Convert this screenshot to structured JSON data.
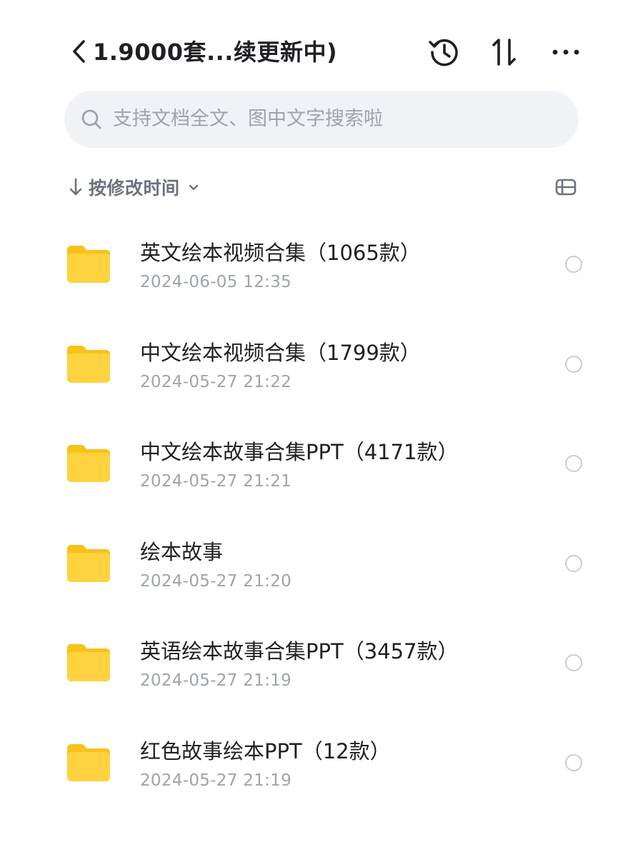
{
  "header": {
    "title": "1.9000套...续更新中)",
    "icons": {
      "back": "chevron-left-icon",
      "history": "history-icon",
      "sort": "sort-arrows-icon",
      "more": "more-dots-icon"
    }
  },
  "search": {
    "placeholder": "支持文档全文、图中文字搜索啦",
    "icon": "search-icon"
  },
  "sort": {
    "label": "按修改时间",
    "icon": "arrow-down-icon",
    "dropdown_icon": "chevron-down-icon",
    "view_icon": "list-view-icon"
  },
  "files": [
    {
      "name": "英文绘本视频合集（1065款）",
      "date": "2024-06-05 12:35",
      "type": "folder"
    },
    {
      "name": "中文绘本视频合集（1799款）",
      "date": "2024-05-27 21:22",
      "type": "folder"
    },
    {
      "name": "中文绘本故事合集PPT（4171款）",
      "date": "2024-05-27 21:21",
      "type": "folder"
    },
    {
      "name": "绘本故事",
      "date": "2024-05-27 21:20",
      "type": "folder"
    },
    {
      "name": "英语绘本故事合集PPT（3457款）",
      "date": "2024-05-27 21:19",
      "type": "folder"
    },
    {
      "name": "红色故事绘本PPT（12款）",
      "date": "2024-05-27 21:19",
      "type": "folder"
    }
  ],
  "colors": {
    "folder": "#FFD23F",
    "folder_tab": "#F8C21B",
    "text_primary": "#1F2023",
    "text_secondary": "#9EA3AD",
    "search_bg": "#F1F2F6"
  }
}
